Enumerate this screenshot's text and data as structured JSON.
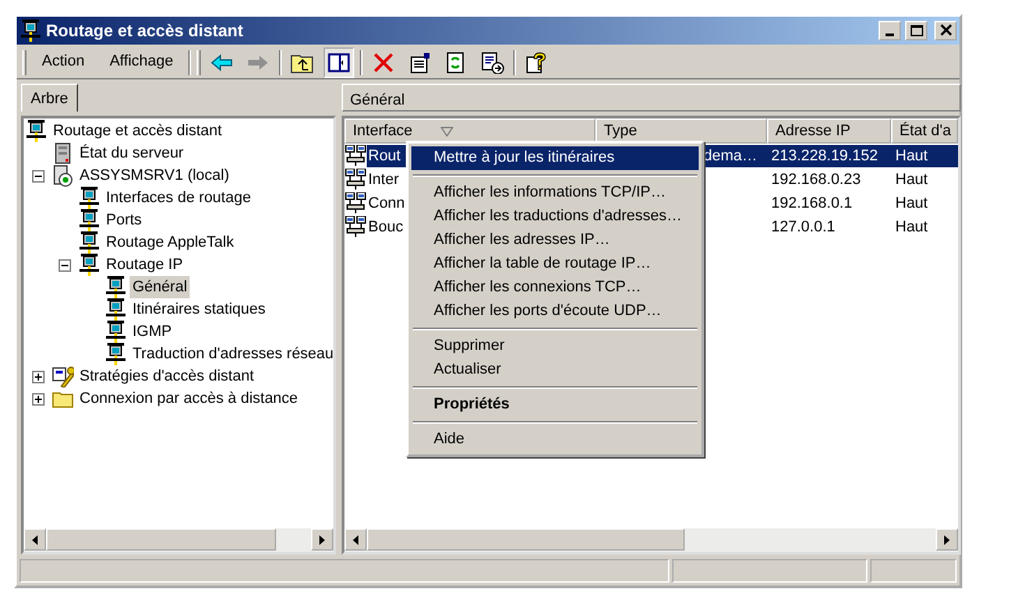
{
  "window": {
    "title": "Routage et accès distant"
  },
  "menu_bar": [
    {
      "label": "Action"
    },
    {
      "label": "Affichage"
    }
  ],
  "left_pane": {
    "tab": "Arbre",
    "tree": [
      {
        "label": "Routage et accès distant",
        "kind": "computer",
        "selected": false,
        "children": [
          {
            "label": "État du serveur",
            "kind": "server",
            "selected": false
          },
          {
            "label": "ASSYSMSRV1 (local)",
            "kind": "host",
            "selected": false,
            "expanded": true,
            "children": [
              {
                "label": "Interfaces de routage",
                "kind": "computer",
                "selected": false
              },
              {
                "label": "Ports",
                "kind": "computer",
                "selected": false
              },
              {
                "label": "Routage AppleTalk",
                "kind": "computer",
                "selected": false
              },
              {
                "label": "Routage IP",
                "kind": "computer",
                "selected": false,
                "expanded": true,
                "children": [
                  {
                    "label": "Général",
                    "kind": "computer",
                    "selected": true
                  },
                  {
                    "label": "Itinéraires statiques",
                    "kind": "computer",
                    "selected": false
                  },
                  {
                    "label": "IGMP",
                    "kind": "computer",
                    "selected": false
                  },
                  {
                    "label": "Traduction d'adresses réseau",
                    "kind": "computer",
                    "selected": false
                  }
                ]
              }
            ]
          },
          {
            "label": "Stratégies d'accès distant",
            "kind": "policy",
            "selected": false,
            "expanded": false
          },
          {
            "label": "Connexion par accès à distance",
            "kind": "folder",
            "selected": false,
            "expanded": false
          }
        ]
      }
    ]
  },
  "right_pane": {
    "header": "Général",
    "columns": [
      "Interface",
      "Type",
      "Adresse IP",
      "État d'a"
    ],
    "rows": [
      {
        "interface": "Rout",
        "type": "dema…",
        "address": "213.228.19.152",
        "state": "Haut",
        "selected": true
      },
      {
        "interface": "Inter",
        "address": "192.168.0.23",
        "state": "Haut",
        "selected": false
      },
      {
        "interface": "Conn",
        "address": "192.168.0.1",
        "state": "Haut",
        "selected": false
      },
      {
        "interface": "Bouc",
        "address": "127.0.0.1",
        "state": "Haut",
        "selected": false
      }
    ]
  },
  "context_menu": [
    {
      "kind": "item",
      "label": "Mettre à jour les itinéraires",
      "selected": true,
      "default": false
    },
    {
      "kind": "separator"
    },
    {
      "kind": "item",
      "label": "Afficher les informations TCP/IP…",
      "selected": false,
      "default": false
    },
    {
      "kind": "item",
      "label": "Afficher les traductions d'adresses…",
      "selected": false,
      "default": false
    },
    {
      "kind": "item",
      "label": "Afficher les adresses IP…",
      "selected": false,
      "default": false
    },
    {
      "kind": "item",
      "label": "Afficher la table de routage IP…",
      "selected": false,
      "default": false
    },
    {
      "kind": "item",
      "label": "Afficher les connexions TCP…",
      "selected": false,
      "default": false
    },
    {
      "kind": "item",
      "label": "Afficher les ports d'écoute UDP…",
      "selected": false,
      "default": false
    },
    {
      "kind": "separator"
    },
    {
      "kind": "item",
      "label": "Supprimer",
      "selected": false,
      "default": false
    },
    {
      "kind": "item",
      "label": "Actualiser",
      "selected": false,
      "default": false
    },
    {
      "kind": "separator"
    },
    {
      "kind": "item",
      "label": "Propriétés",
      "selected": false,
      "default": true
    },
    {
      "kind": "separator"
    },
    {
      "kind": "item",
      "label": "Aide",
      "selected": false,
      "default": false
    }
  ]
}
